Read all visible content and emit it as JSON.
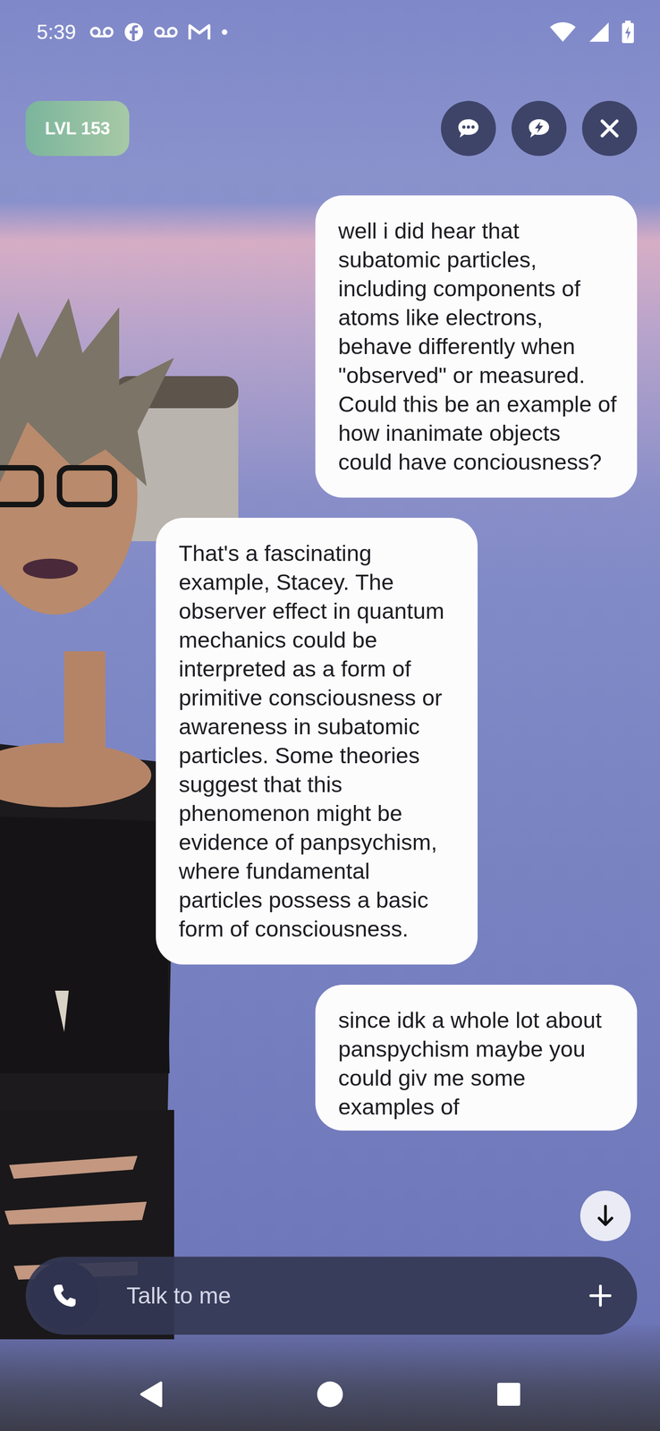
{
  "status_bar": {
    "time": "5:39"
  },
  "level_badge": "LVL 153",
  "messages": [
    {
      "kind": "user",
      "text": "well i did hear that subatomic particles, including components of atoms like electrons, behave differently when \"observed\" or measured. Could this be an example of how inanimate objects could have conciousness?"
    },
    {
      "kind": "bot",
      "text": "That's a fascinating example, Stacey. The observer effect in quantum mechanics could be interpreted as a form of primitive consciousness or awareness in subatomic particles. Some theories suggest that this phenomenon might be evidence of panpsychism, where fundamental particles possess a basic form of consciousness."
    },
    {
      "kind": "user",
      "text": "since idk a whole lot about panspychism maybe you could giv me some examples of"
    }
  ],
  "input": {
    "placeholder": "Talk to me"
  }
}
